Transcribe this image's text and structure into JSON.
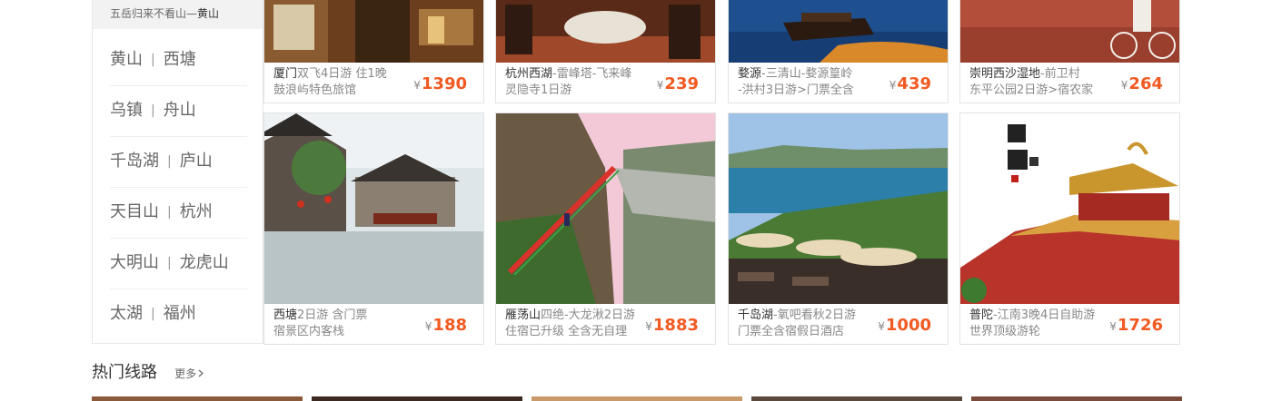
{
  "sidebar": {
    "header_prefix": "五岳归来不看山—",
    "header_highlight": "黄山",
    "rows": [
      {
        "a": "黄山",
        "b": "西塘"
      },
      {
        "a": "乌镇",
        "b": "舟山"
      },
      {
        "a": "千岛湖",
        "b": "庐山"
      },
      {
        "a": "天目山",
        "b": "杭州"
      },
      {
        "a": "大明山",
        "b": "龙虎山"
      },
      {
        "a": "太湖",
        "b": "福州"
      }
    ],
    "separator": "|"
  },
  "currency": "¥",
  "top_cards": [
    {
      "dest": "厦门",
      "rest": "双飞4日游  住1晚",
      "line2": "鼓浪屿特色旅馆",
      "price": "1390",
      "color": "#7a4a22"
    },
    {
      "dest": "杭州西湖",
      "rest": "-雷峰塔-飞来峰",
      "line2": "灵隐寺1日游",
      "price": "239",
      "color": "#8b4a2a"
    },
    {
      "dest": "婺源",
      "rest": "-三清山-婺源篁岭",
      "line2": "-洪村3日游>门票全含",
      "price": "439",
      "color": "#1c4a86"
    },
    {
      "dest": "崇明西沙湿地",
      "rest": "-前卫村",
      "line2": "东平公园2日游>宿农家",
      "price": "264",
      "color": "#a04a38"
    }
  ],
  "bottom_cards": [
    {
      "dest": "西塘",
      "rest": "2日游 含门票",
      "line2": "宿景区内客栈",
      "price": "188"
    },
    {
      "dest": "雁荡山",
      "rest": "四绝-大龙湫2日游",
      "line2": "住宿已升级 全含无自理",
      "price": "1883"
    },
    {
      "dest": "千岛湖",
      "rest": "-氧吧看秋2日游",
      "line2": "门票全含宿假日酒店",
      "price": "1000"
    },
    {
      "dest": "普陀",
      "rest": "-江南3晚4日自助游",
      "line2": "世界顶级游轮",
      "price": "1726"
    }
  ],
  "section": {
    "title": "热门线路",
    "more": "更多"
  },
  "colors": {
    "accent": "#f15a22",
    "border": "#e2e2e2",
    "header_bg": "#f2f2f2"
  }
}
